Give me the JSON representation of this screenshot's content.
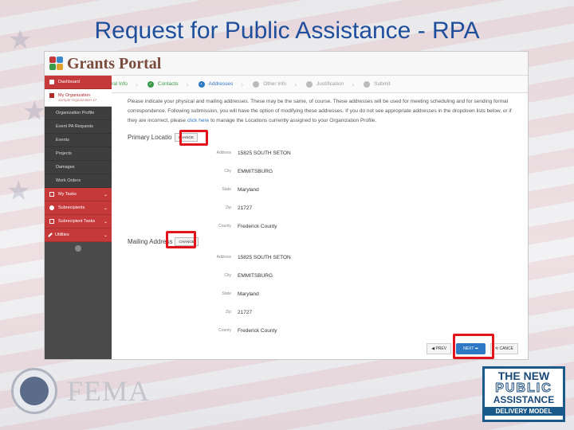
{
  "slide": {
    "title": "Request for Public Assistance - RPA"
  },
  "app": {
    "logo_text": "Grants Portal",
    "sidebar": {
      "dashboard": "Dashboard",
      "my_org": "My Organization",
      "my_org_sub": "Sample Organization 17",
      "org_profile": "Organization Profile",
      "event_requests": "Event PA Requests",
      "events": "Events",
      "projects": "Projects",
      "damages": "Damages",
      "work_orders": "Work Orders",
      "my_tasks": "My Tasks",
      "subrecipients": "Subrecipients",
      "subrecipient_tasks": "Subrecipient Tasks",
      "utilities": "Utilities"
    },
    "steps": [
      {
        "label": "ral Info",
        "state": "done"
      },
      {
        "label": "Contacts",
        "state": "done"
      },
      {
        "label": "Addresses",
        "state": "active"
      },
      {
        "label": "Other Info",
        "state": "todo"
      },
      {
        "label": "Justification",
        "state": "todo"
      },
      {
        "label": "Submit",
        "state": "todo"
      }
    ],
    "intro_text": "Please indicate your physical and mailing addresses. These may be the same, of course. These addresses will be used for meeting scheduling and for sending formal correspondence. Following submission, you will have the option of modifying these addresses. If you do not see appropriate addresses in the dropdown lists below, or if they are incorrect, please ",
    "intro_link": "click here",
    "intro_end": " to manage the Locations currently assigned to your Organization Profile.",
    "primary": {
      "title": "Primary Locatio",
      "change_label": "CHANGE",
      "fields": [
        {
          "label": "Address",
          "value": "15825 SOUTH SETON"
        },
        {
          "label": "City",
          "value": "EMMITSBURG"
        },
        {
          "label": "State",
          "value": "Maryland"
        },
        {
          "label": "Zip",
          "value": "21727"
        },
        {
          "label": "County",
          "value": "Frederick County"
        }
      ]
    },
    "mailing": {
      "title": "Mailing Address",
      "change_label": "CHANGE",
      "fields": [
        {
          "label": "Address",
          "value": "15825 SOUTH SETON"
        },
        {
          "label": "City",
          "value": "EMMITSBURG"
        },
        {
          "label": "State",
          "value": "Maryland"
        },
        {
          "label": "Zip",
          "value": "21727"
        },
        {
          "label": "County",
          "value": "Frederick County"
        }
      ]
    },
    "buttons": {
      "prev": "◀ PREV",
      "next": "NEXT ➡",
      "cancel": "⟲ CANCE"
    }
  },
  "footer": {
    "fema_text": "FEMA",
    "pa_line1": "THE NEW",
    "pa_line2": "PUBLIC",
    "pa_line3": "ASSISTANCE",
    "pa_line4": "DELIVERY MODEL"
  },
  "colors": {
    "title_blue": "#1f4e9c",
    "highlight_red": "#e2131a",
    "sidebar_red": "#c6393a",
    "next_blue": "#2e78c6"
  }
}
